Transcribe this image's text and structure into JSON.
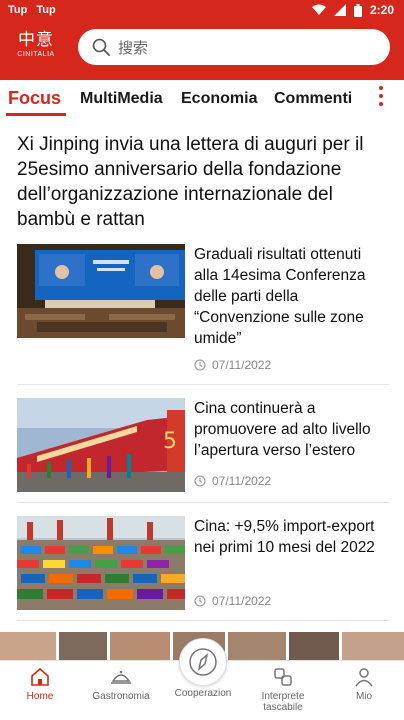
{
  "status_bar": {
    "left_items": [
      "Tup",
      "Tup"
    ],
    "time": "2:20"
  },
  "header": {
    "logo_zh": "中意",
    "logo_latin": "CINITALIA",
    "search_placeholder": "搜索",
    "icons": [
      "search-icon"
    ]
  },
  "tabs": [
    {
      "label": "Focus",
      "active": true
    },
    {
      "label": "MultiMedia",
      "active": false
    },
    {
      "label": "Economia",
      "active": false
    },
    {
      "label": "Commenti",
      "active": false
    }
  ],
  "headline": "Xi Jinping invia una lettera di auguri per il 25esimo anniversario della fondazione dell’organizzazione internazionale del bambù e rattan",
  "articles": [
    {
      "title": "Graduali risultati ottenuti alla 14esima Conferenza delle parti della “Convenzione sulle zone umide”",
      "date": "07/11/2022"
    },
    {
      "title": "Cina continuerà a promuovere ad alto livello l’apertura verso l’estero",
      "date": "07/11/2022"
    },
    {
      "title": "Cina: +9,5% import-export nei primi 10 mesi del 2022",
      "date": "07/11/2022"
    }
  ],
  "bottom_nav": [
    {
      "label": "Home",
      "icon": "home-icon",
      "active": true
    },
    {
      "label": "Gastronomia",
      "icon": "dish-icon",
      "active": false
    },
    {
      "label": "Cooperazion",
      "icon": "compass-icon",
      "active": false
    },
    {
      "label": "Interprete tascabile",
      "icon": "translate-icon",
      "active": false
    },
    {
      "label": "Mio",
      "icon": "user-icon",
      "active": false
    }
  ],
  "colors": {
    "accent": "#d5271c",
    "text": "#111111",
    "muted": "#888888"
  }
}
